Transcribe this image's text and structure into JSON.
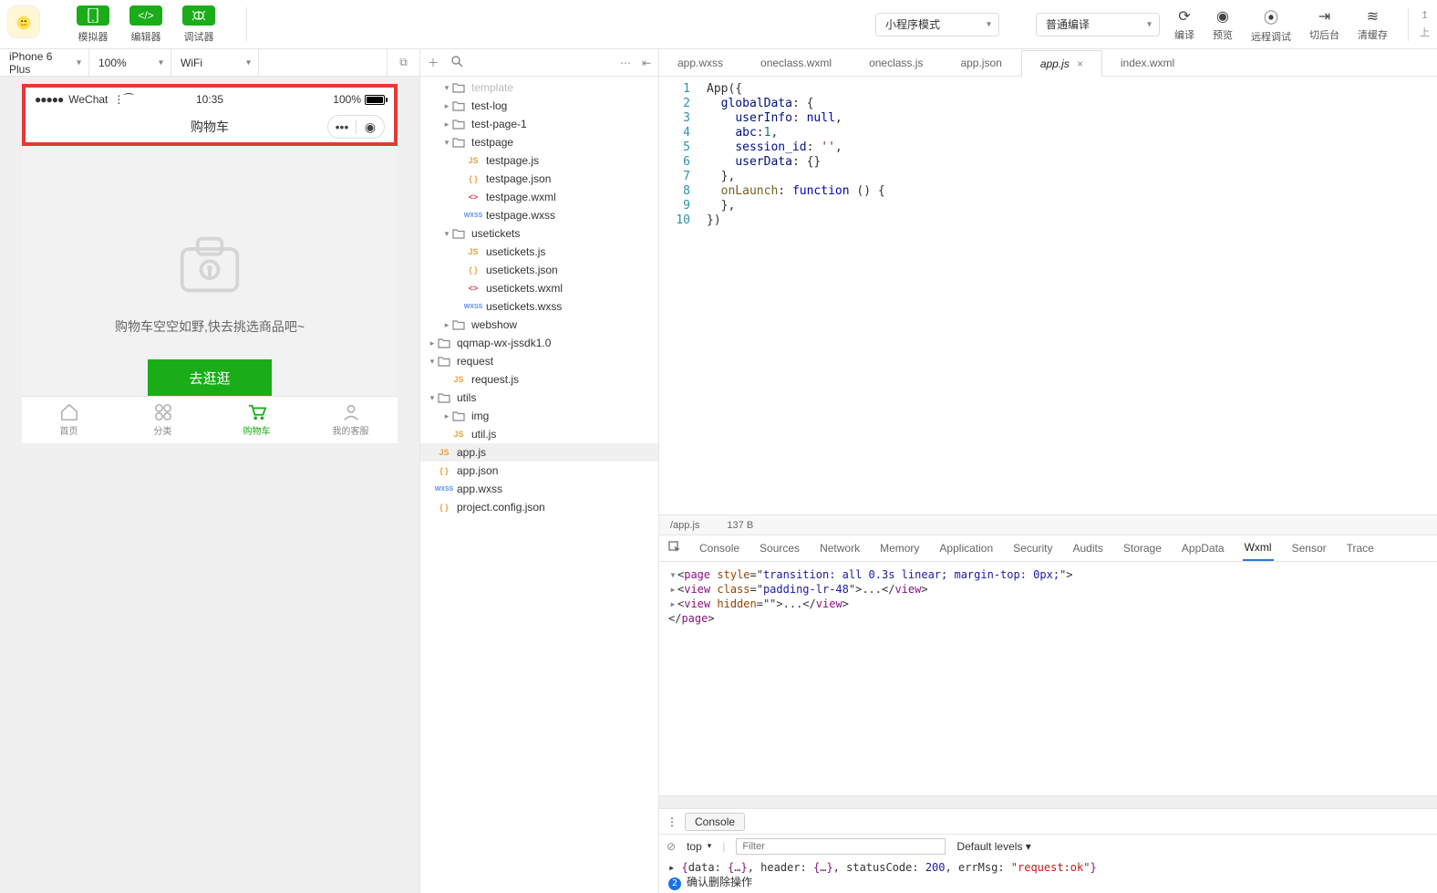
{
  "toolbar": {
    "sim_label": "模拟器",
    "editor_label": "编辑器",
    "debugger_label": "调试器",
    "mode": "小程序模式",
    "compile_mode": "普通编译",
    "compile": "编译",
    "preview": "预览",
    "remote_debug": "远程调试",
    "background": "切后台",
    "clear_cache": "清缓存",
    "cut": "上"
  },
  "simbar": {
    "device": "iPhone 6 Plus",
    "zoom": "100%",
    "network": "WiFi"
  },
  "device": {
    "carrier": "WeChat",
    "time": "10:35",
    "battery": "100%",
    "page_title": "购物车",
    "empty_text": "购物车空空如野,快去挑选商品吧~",
    "go_button": "去逛逛",
    "tabs": {
      "home": "首页",
      "category": "分类",
      "cart": "购物车",
      "mine": "我的客服"
    }
  },
  "tree": [
    {
      "d": 1,
      "t": "folder",
      "name": "template",
      "exp": true,
      "gray": true
    },
    {
      "d": 1,
      "t": "folder",
      "name": "test-log",
      "exp": false
    },
    {
      "d": 1,
      "t": "folder",
      "name": "test-page-1",
      "exp": false
    },
    {
      "d": 1,
      "t": "folder",
      "name": "testpage",
      "exp": true
    },
    {
      "d": 2,
      "t": "js",
      "name": "testpage.js"
    },
    {
      "d": 2,
      "t": "json",
      "name": "testpage.json"
    },
    {
      "d": 2,
      "t": "wxml",
      "name": "testpage.wxml"
    },
    {
      "d": 2,
      "t": "wxss",
      "name": "testpage.wxss"
    },
    {
      "d": 1,
      "t": "folder",
      "name": "usetickets",
      "exp": true
    },
    {
      "d": 2,
      "t": "js",
      "name": "usetickets.js"
    },
    {
      "d": 2,
      "t": "json",
      "name": "usetickets.json"
    },
    {
      "d": 2,
      "t": "wxml",
      "name": "usetickets.wxml"
    },
    {
      "d": 2,
      "t": "wxss",
      "name": "usetickets.wxss"
    },
    {
      "d": 1,
      "t": "folder",
      "name": "webshow",
      "exp": false
    },
    {
      "d": 0,
      "t": "folder",
      "name": "qqmap-wx-jssdk1.0",
      "exp": false
    },
    {
      "d": 0,
      "t": "folder",
      "name": "request",
      "exp": true
    },
    {
      "d": 1,
      "t": "js",
      "name": "request.js"
    },
    {
      "d": 0,
      "t": "folder",
      "name": "utils",
      "exp": true
    },
    {
      "d": 1,
      "t": "folder",
      "name": "img",
      "exp": false
    },
    {
      "d": 1,
      "t": "js",
      "name": "util.js"
    },
    {
      "d": 0,
      "t": "js",
      "name": "app.js",
      "active": true
    },
    {
      "d": 0,
      "t": "json",
      "name": "app.json"
    },
    {
      "d": 0,
      "t": "wxss",
      "name": "app.wxss"
    },
    {
      "d": 0,
      "t": "json",
      "name": "project.config.json"
    }
  ],
  "editor_tabs": [
    {
      "name": "app.wxss"
    },
    {
      "name": "oneclass.wxml"
    },
    {
      "name": "oneclass.js"
    },
    {
      "name": "app.json"
    },
    {
      "name": "app.js",
      "active": true,
      "closable": true
    },
    {
      "name": "index.wxml"
    }
  ],
  "code": {
    "lines": [
      1,
      2,
      3,
      4,
      5,
      6,
      7,
      8,
      9,
      10
    ],
    "html": "App({\n  <span class='ident'>globalData</span>: {\n    <span class='ident'>userInfo</span>: <span class='kw'>null</span>,\n    <span class='ident'>abc</span>:<span class='num'>1</span>,\n    <span class='ident'>session_id</span>: <span class='str'>''</span>,\n    <span class='ident'>userData</span>: {}\n  },\n  <span class='fn'>onLaunch</span>: <span class='kw'>function</span> () {\n  },\n})"
  },
  "status": {
    "path": "/app.js",
    "size": "137 B"
  },
  "devtools": {
    "tabs": [
      "Console",
      "Sources",
      "Network",
      "Memory",
      "Application",
      "Security",
      "Audits",
      "Storage",
      "AppData",
      "Wxml",
      "Sensor",
      "Trace"
    ],
    "active": "Wxml",
    "wxml": "<span class='tw'>▾</span>&lt;<span class='tag'>page</span> <span class='attr'>style</span>=\"<span class='val'>transition: all 0.3s linear; margin-top: 0px;</span>\"&gt;\n  <span class='tw'>▸</span>&lt;<span class='tag'>view</span> <span class='attr'>class</span>=\"<span class='val'>padding-lr-48</span>\"&gt;...&lt;/<span class='tag'>view</span>&gt;\n  <span class='tw'>▸</span>&lt;<span class='tag'>view</span> <span class='attr'>hidden</span>=\"\"&gt;...&lt;/<span class='tag'>view</span>&gt;\n&lt;/<span class='tag'>page</span>&gt;"
  },
  "console": {
    "label": "Console",
    "context": "top",
    "filter_placeholder": "Filter",
    "levels": "Default levels ▾",
    "line1": "▸ <span class='kw2'>{</span>data: <span class='kw2'>{…}</span>, header: <span class='kw2'>{…}</span>, statusCode: <span class='num2'>200</span>, errMsg: <span class='str2'>\"request:ok\"</span><span class='kw2'>}</span>",
    "line2_badge": "2",
    "line2": "确认删除操作"
  }
}
